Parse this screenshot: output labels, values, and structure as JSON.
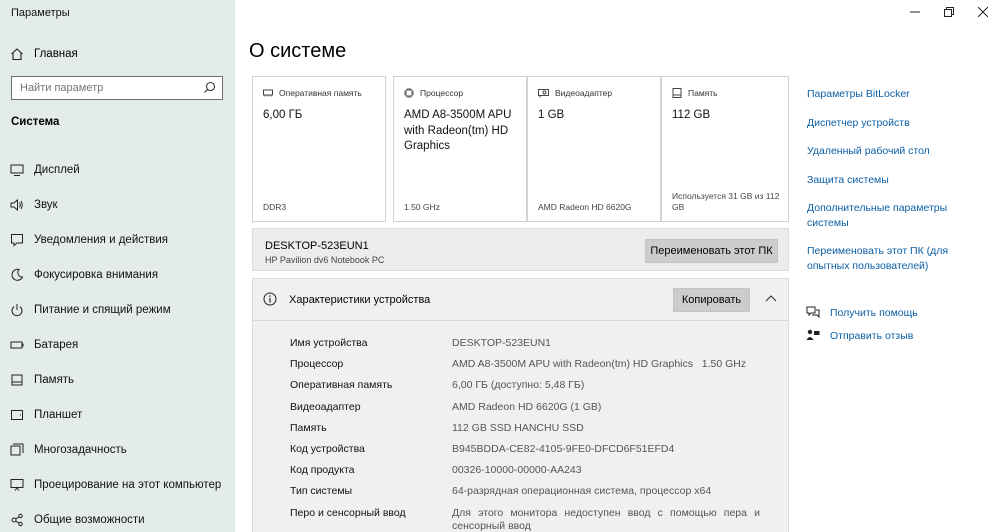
{
  "app_title": "Параметры",
  "sidebar": {
    "home_label": "Главная",
    "search_placeholder": "Найти параметр",
    "section_title": "Система",
    "items": [
      {
        "label": "Дисплей"
      },
      {
        "label": "Звук"
      },
      {
        "label": "Уведомления и действия"
      },
      {
        "label": "Фокусировка внимания"
      },
      {
        "label": "Питание и спящий режим"
      },
      {
        "label": "Батарея"
      },
      {
        "label": "Память"
      },
      {
        "label": "Планшет"
      },
      {
        "label": "Многозадачность"
      },
      {
        "label": "Проецирование на этот компьютер"
      },
      {
        "label": "Общие возможности"
      }
    ]
  },
  "main": {
    "title": "О системе",
    "cards": [
      {
        "label": "Оперативная память",
        "value": "6,00 ГБ",
        "sub": "DDR3",
        "icon": "ram-icon"
      },
      {
        "label": "Процессор",
        "value": "AMD A8-3500M APU with Radeon(tm) HD Graphics",
        "sub": "1.50 GHz",
        "icon": "cpu-icon"
      },
      {
        "label": "Видеоадаптер",
        "value": "1 GB",
        "sub": "AMD Radeon HD 6620G",
        "icon": "gpu-icon"
      },
      {
        "label": "Память",
        "value": "112 GB",
        "sub": "Используется 31 GB из 112 GB",
        "icon": "storage-icon"
      }
    ],
    "device": {
      "name": "DESKTOP-523EUN1",
      "model": "HP Pavilion dv6 Notebook PC",
      "rename_label": "Переименовать этот ПК"
    },
    "specs": {
      "title": "Характеристики устройства",
      "copy_label": "Копировать",
      "rows": [
        {
          "key": "Имя устройства",
          "value": "DESKTOP-523EUN1"
        },
        {
          "key": "Процессор",
          "value": "AMD A8-3500M APU with Radeon(tm) HD Graphics   1.50 GHz"
        },
        {
          "key": "Оперативная память",
          "value": "6,00 ГБ (доступно: 5,48 ГБ)"
        },
        {
          "key": "Видеоадаптер",
          "value": "AMD Radeon HD 6620G (1 GB)"
        },
        {
          "key": "Память",
          "value": "112 GB SSD HANCHU SSD"
        },
        {
          "key": "Код устройства",
          "value": "B945BDDA-CE82-4105-9FE0-DFCD6F51EFD4"
        },
        {
          "key": "Код продукта",
          "value": "00326-10000-00000-AA243"
        },
        {
          "key": "Тип системы",
          "value": "64-разрядная операционная система, процессор x64"
        },
        {
          "key": "Перо и сенсорный ввод",
          "value": "Для этого монитора недоступен ввод с помощью пера и сенсорный ввод"
        }
      ]
    }
  },
  "right": {
    "links": [
      "Параметры BitLocker",
      "Диспетчер устройств",
      "Удаленный рабочий стол",
      "Защита системы",
      "Дополнительные параметры системы",
      "Переименовать этот ПК (для опытных пользователей)"
    ],
    "help_label": "Получить помощь",
    "feedback_label": "Отправить отзыв"
  },
  "colors": {
    "sidebar_bg": "#e3ece6",
    "link": "#0b5fa5",
    "button": "#cccccc"
  }
}
